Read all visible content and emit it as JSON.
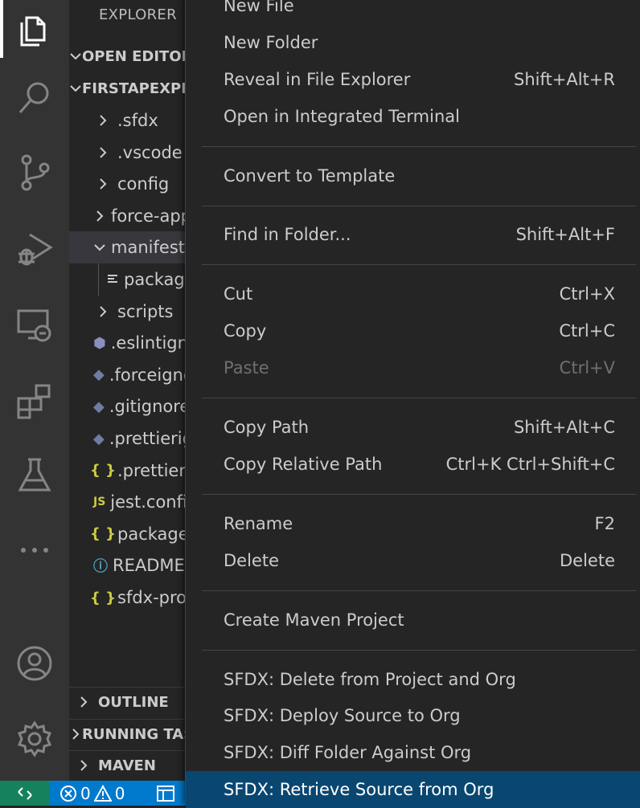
{
  "colors": {
    "activity_bar": "#333333",
    "sidebar": "#252526",
    "status_bar": "#007acc",
    "remote": "#16825d",
    "menu_highlight": "#094771"
  },
  "activity_bar": {
    "items": [
      {
        "name": "explorer-icon",
        "active": true
      },
      {
        "name": "search-icon"
      },
      {
        "name": "source-control-icon"
      },
      {
        "name": "run-debug-icon"
      },
      {
        "name": "remote-explorer-icon"
      },
      {
        "name": "extensions-icon"
      },
      {
        "name": "testing-icon"
      },
      {
        "name": "more-icon"
      },
      {
        "name": "accounts-icon"
      },
      {
        "name": "settings-gear-icon"
      }
    ]
  },
  "sidebar": {
    "title": "EXPLORER",
    "open_editors": "OPEN EDITORS",
    "project": "FIRSTAPEXPROJECT",
    "tree": [
      {
        "label": ".sfdx",
        "kind": "folder"
      },
      {
        "label": ".vscode",
        "kind": "folder"
      },
      {
        "label": "config",
        "kind": "folder"
      },
      {
        "label": "force-app",
        "kind": "folder"
      },
      {
        "label": "manifest",
        "kind": "folder-open",
        "selected": true
      },
      {
        "label": "package.xml",
        "kind": "file-lines"
      },
      {
        "label": "scripts",
        "kind": "folder"
      },
      {
        "label": ".eslintignore",
        "kind": "eslint",
        "icon": "⬢"
      },
      {
        "label": ".forceignore",
        "kind": "diamond",
        "icon": "◆"
      },
      {
        "label": ".gitignore",
        "kind": "diamond",
        "icon": "◆"
      },
      {
        "label": ".prettierignore",
        "kind": "diamond",
        "icon": "◆"
      },
      {
        "label": ".prettierrc",
        "kind": "json",
        "icon": "{ }"
      },
      {
        "label": "jest.config.js",
        "kind": "js",
        "icon": "JS"
      },
      {
        "label": "package.json",
        "kind": "json",
        "icon": "{ }"
      },
      {
        "label": "README.md",
        "kind": "info",
        "icon": "ⓘ"
      },
      {
        "label": "sfdx-project.json",
        "kind": "json",
        "icon": "{ }"
      }
    ],
    "outline": "OUTLINE",
    "running_tasks": "RUNNING TASKS",
    "maven": "MAVEN"
  },
  "status_bar": {
    "errors": "0",
    "warnings": "0"
  },
  "context_menu": {
    "items": [
      {
        "label": "New File",
        "shortcut": ""
      },
      {
        "label": "New Folder",
        "shortcut": ""
      },
      {
        "label": "Reveal in File Explorer",
        "shortcut": "Shift+Alt+R"
      },
      {
        "label": "Open in Integrated Terminal",
        "shortcut": ""
      },
      {
        "separator": true
      },
      {
        "label": "Convert to Template",
        "shortcut": ""
      },
      {
        "separator": true
      },
      {
        "label": "Find in Folder...",
        "shortcut": "Shift+Alt+F"
      },
      {
        "separator": true
      },
      {
        "label": "Cut",
        "shortcut": "Ctrl+X"
      },
      {
        "label": "Copy",
        "shortcut": "Ctrl+C"
      },
      {
        "label": "Paste",
        "shortcut": "Ctrl+V",
        "disabled": true
      },
      {
        "separator": true
      },
      {
        "label": "Copy Path",
        "shortcut": "Shift+Alt+C"
      },
      {
        "label": "Copy Relative Path",
        "shortcut": "Ctrl+K Ctrl+Shift+C"
      },
      {
        "separator": true
      },
      {
        "label": "Rename",
        "shortcut": "F2"
      },
      {
        "label": "Delete",
        "shortcut": "Delete"
      },
      {
        "separator": true
      },
      {
        "label": "Create Maven Project",
        "shortcut": ""
      },
      {
        "separator": true
      },
      {
        "label": "SFDX: Delete from Project and Org",
        "shortcut": ""
      },
      {
        "label": "SFDX: Deploy Source to Org",
        "shortcut": ""
      },
      {
        "label": "SFDX: Diff Folder Against Org",
        "shortcut": ""
      },
      {
        "label": "SFDX: Retrieve Source from Org",
        "shortcut": "",
        "highlighted": true
      }
    ]
  }
}
